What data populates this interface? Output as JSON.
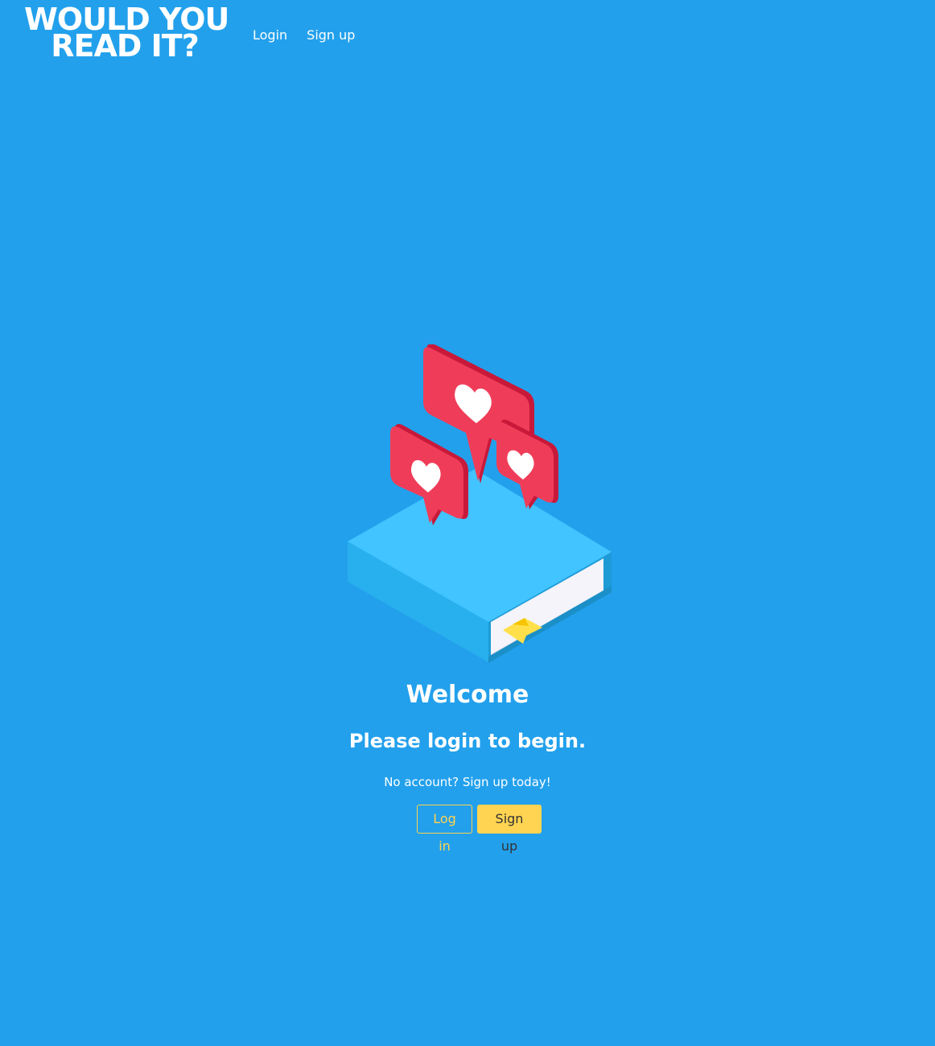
{
  "navbar": {
    "brand": {
      "line1": "WOULD YOU",
      "line2": "READ IT?"
    },
    "links": {
      "login": "Login",
      "signup": "Sign up"
    }
  },
  "main": {
    "illustration": "book-with-heart-bubbles-illustration",
    "welcome": "Welcome",
    "subheading": "Please login to begin.",
    "prompt": "No account? Sign up today!",
    "buttons": {
      "login": "Log in",
      "signup": "Sign up"
    }
  },
  "colors": {
    "background": "#22a0ec",
    "accent": "#ffd452",
    "heart_bubble": "#ef3d59",
    "book": "#41c4ff"
  }
}
